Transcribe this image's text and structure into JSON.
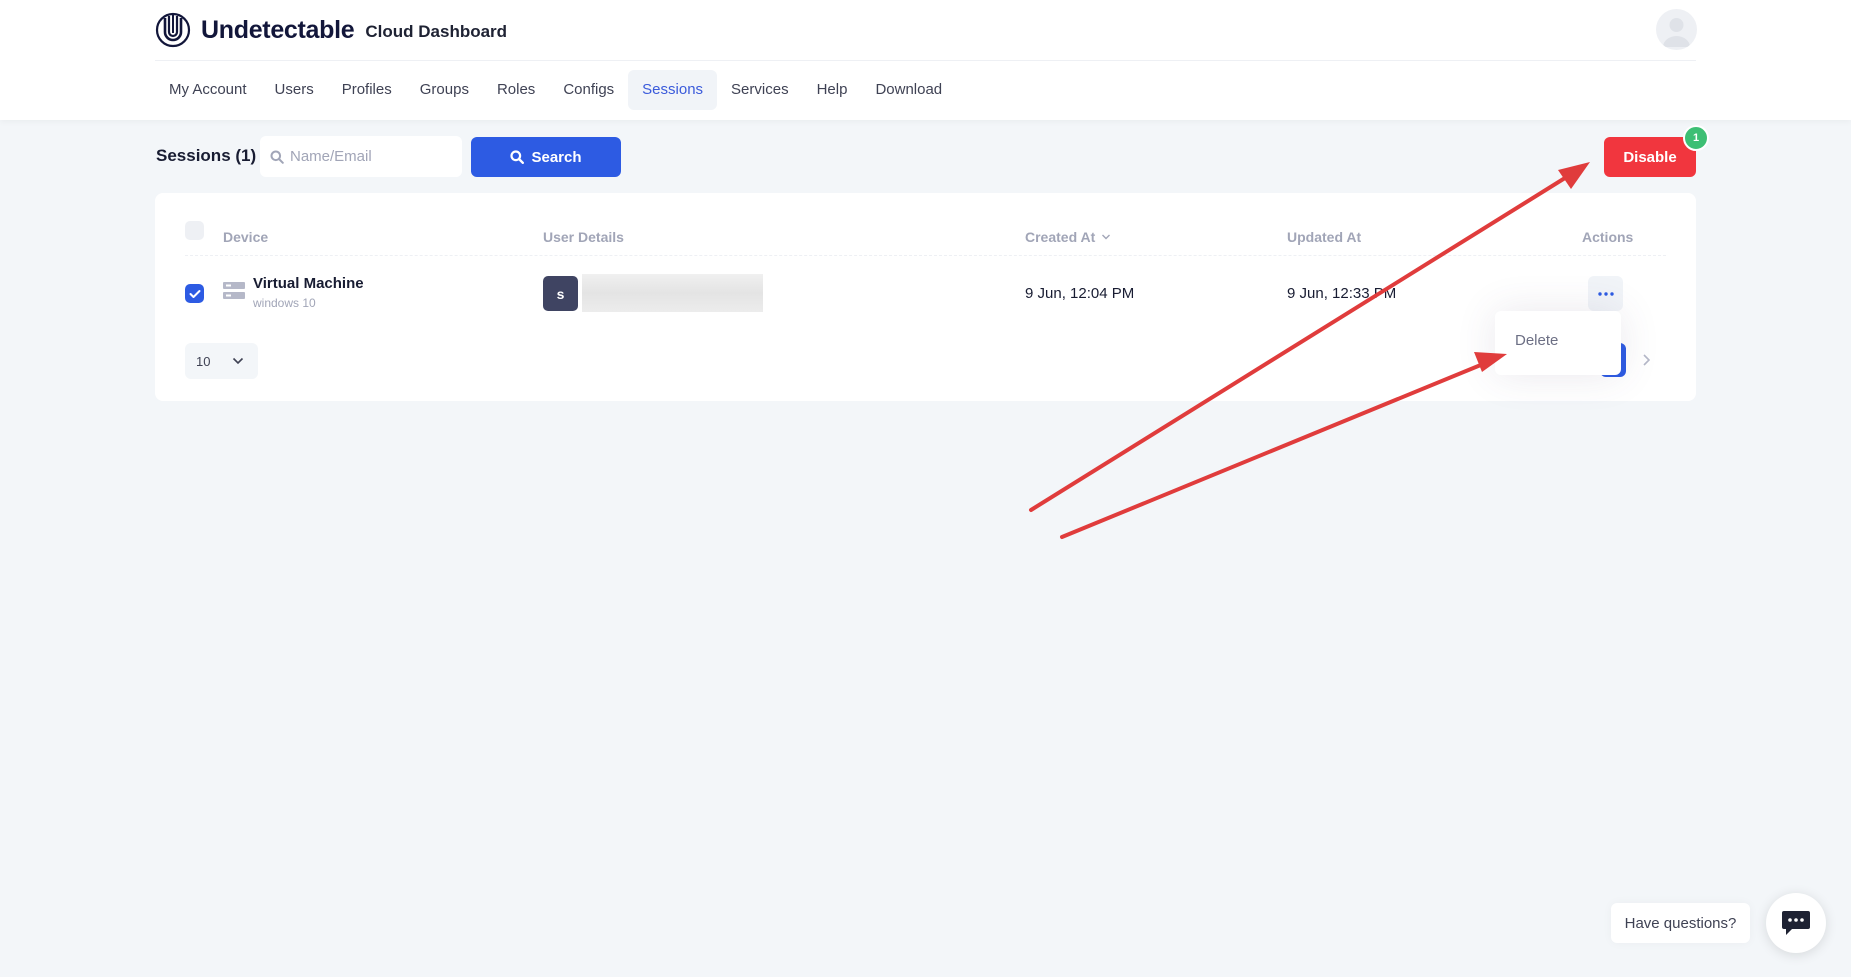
{
  "brand": {
    "name": "Undetectable",
    "subtitle": "Cloud Dashboard",
    "logo_icon": "undetectable-logo-icon"
  },
  "user": {
    "avatar_icon": "user-avatar-icon"
  },
  "nav": {
    "items": [
      {
        "label": "My Account"
      },
      {
        "label": "Users"
      },
      {
        "label": "Profiles"
      },
      {
        "label": "Groups"
      },
      {
        "label": "Roles"
      },
      {
        "label": "Configs"
      },
      {
        "label": "Sessions",
        "active": true
      },
      {
        "label": "Services"
      },
      {
        "label": "Help"
      },
      {
        "label": "Download"
      }
    ]
  },
  "toolbar": {
    "title": "Sessions (1)",
    "search_placeholder": "Name/Email",
    "search_label": "Search",
    "disable_label": "Disable",
    "selected_count": "1"
  },
  "table": {
    "columns": {
      "device": "Device",
      "user_details": "User Details",
      "created_at": "Created At",
      "updated_at": "Updated At",
      "actions": "Actions"
    },
    "rows": [
      {
        "checked": true,
        "device_name": "Virtual Machine",
        "device_os": "windows 10",
        "user_initial": "s",
        "created_at": "9 Jun, 12:04 PM",
        "updated_at": "9 Jun, 12:33 PM"
      }
    ],
    "page_size": "10"
  },
  "actions_menu": {
    "items": [
      {
        "label": "Delete"
      }
    ]
  },
  "help": {
    "label": "Have questions?",
    "icon": "chat-icon"
  },
  "colors": {
    "primary": "#2d5be3",
    "danger": "#f1363e",
    "badge": "#3dbf74",
    "annotation_arrow": "#e03c3c"
  }
}
